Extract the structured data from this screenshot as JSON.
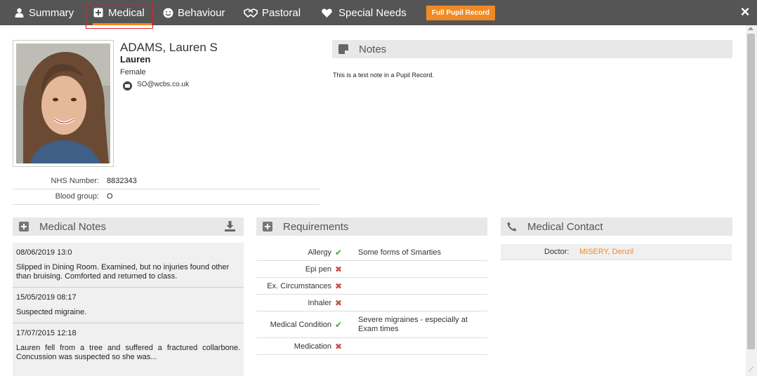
{
  "tabs": [
    {
      "label": "Summary",
      "icon": "user-icon"
    },
    {
      "label": "Medical",
      "icon": "medical-plus-icon"
    },
    {
      "label": "Behaviour",
      "icon": "smiley-icon"
    },
    {
      "label": "Pastoral",
      "icon": "handshake-icon"
    },
    {
      "label": "Special Needs",
      "icon": "heart-icon"
    }
  ],
  "full_record_button": "Full Pupil Record",
  "close_icon": "×",
  "pupil": {
    "name": "ADAMS, Lauren S",
    "preferred_name": "Lauren",
    "gender": "Female",
    "email": "SO@wcbs.co.uk"
  },
  "info": [
    {
      "label": "NHS Number:",
      "value": "8832343"
    },
    {
      "label": "Blood group:",
      "value": "O"
    }
  ],
  "notes": {
    "title": "Notes",
    "text": "This is a test note in a Pupil Record."
  },
  "medical_notes": {
    "title": "Medical Notes",
    "items": [
      {
        "date": "08/06/2019 13:0",
        "text": "Slipped in Dining Room. Examined, but no injuries found other than bruising. Comforted and returned to class."
      },
      {
        "date": "15/05/2019 08:17",
        "text": "Suspected migraine."
      },
      {
        "date": "17/07/2015 12:18",
        "text": "Lauren fell from a tree and suffered a fractured collarbone. Concussion was suspected so she was..."
      }
    ]
  },
  "requirements": {
    "title": "Requirements",
    "rows": [
      {
        "label": "Allergy",
        "status": "yes",
        "value": "Some forms of Smarties"
      },
      {
        "label": "Epi pen",
        "status": "no",
        "value": ""
      },
      {
        "label": "Ex. Circumstances",
        "status": "no",
        "value": ""
      },
      {
        "label": "Inhaler",
        "status": "no",
        "value": ""
      },
      {
        "label": "Medical Condition",
        "status": "yes",
        "value": "Severe migraines - especially at Exam times"
      },
      {
        "label": "Medication",
        "status": "no",
        "value": ""
      }
    ]
  },
  "medical_contact": {
    "title": "Medical Contact",
    "label": "Doctor:",
    "value": "MISERY, Denzil"
  },
  "colors": {
    "topbar": "#555555",
    "accent": "#f08a24",
    "tick": "#3aa535",
    "cross": "#c9514b"
  }
}
